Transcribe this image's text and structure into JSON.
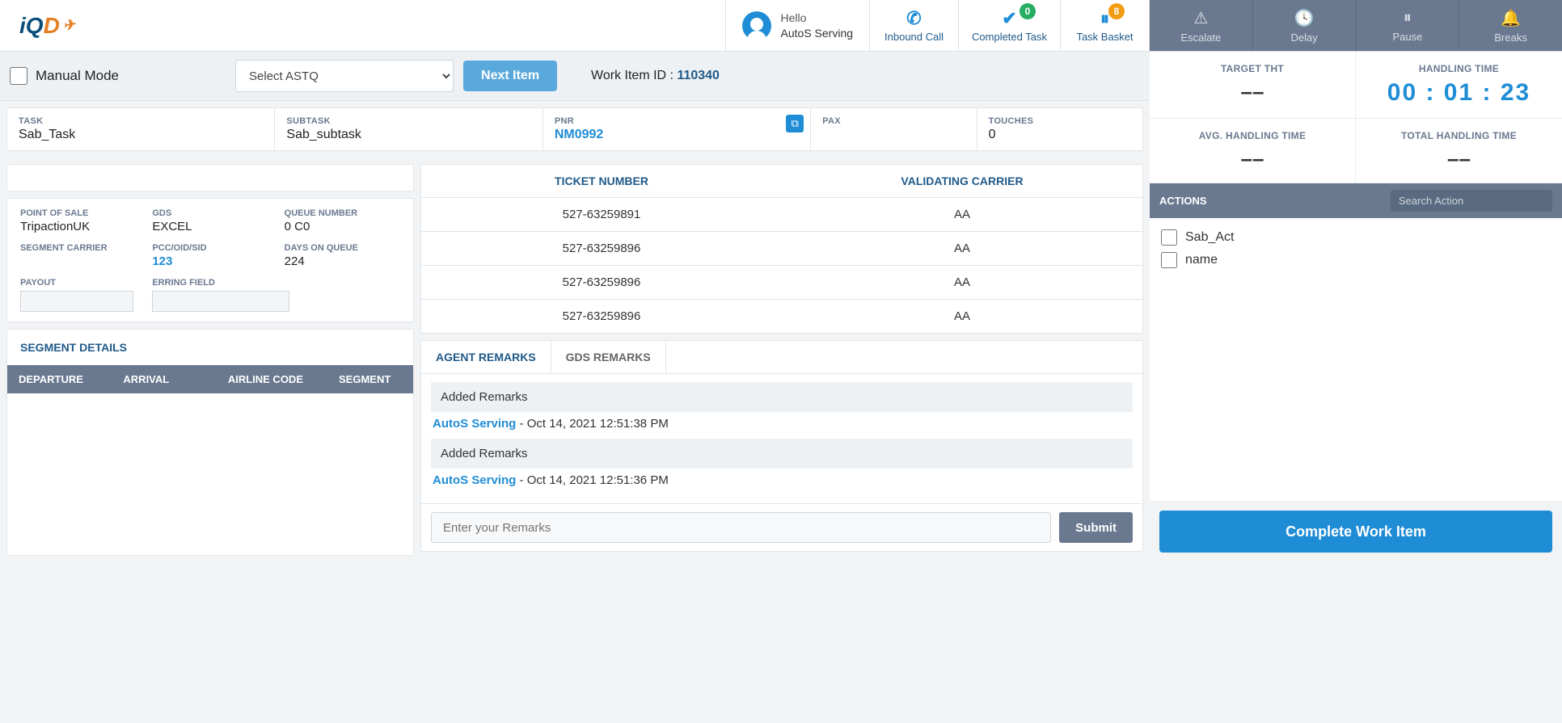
{
  "header": {
    "greeting": "Hello",
    "user_name": "AutoS Serving",
    "inbound_call": "Inbound Call",
    "completed_task": "Completed Task",
    "completed_badge": "0",
    "task_basket": "Task Basket",
    "basket_badge": "8"
  },
  "action_strip": {
    "escalate": "Escalate",
    "delay": "Delay",
    "pause": "Pause",
    "breaks": "Breaks"
  },
  "subbar": {
    "manual_mode": "Manual Mode",
    "select_astq_placeholder": "Select ASTQ",
    "next_item": "Next Item",
    "work_item_label": "Work Item ID :",
    "work_item_id": "110340"
  },
  "info": {
    "task_label": "TASK",
    "task_value": "Sab_Task",
    "subtask_label": "SUBTASK",
    "subtask_value": "Sab_subtask",
    "pnr_label": "PNR",
    "pnr_value": "NM0992",
    "pax_label": "PAX",
    "pax_value": "",
    "touches_label": "TOUCHES",
    "touches_value": "0"
  },
  "details": {
    "pos_label": "POINT OF SALE",
    "pos_value": "TripactionUK",
    "gds_label": "GDS",
    "gds_value": "EXCEL",
    "queue_label": "QUEUE NUMBER",
    "queue_value": "0  C0",
    "seg_carrier_label": "SEGMENT CARRIER",
    "seg_carrier_value": "",
    "pcc_label": "PCC/OID/SID",
    "pcc_value": "123",
    "days_label": "DAYS ON QUEUE",
    "days_value": "224",
    "payout_label": "PAYOUT",
    "erring_label": "ERRING FIELD"
  },
  "segment": {
    "title": "SEGMENT DETAILS",
    "col_dep": "DEPARTURE",
    "col_arr": "ARRIVAL",
    "col_air": "AIRLINE CODE",
    "col_seg": "SEGMENT"
  },
  "tickets": {
    "col_ticket": "TICKET NUMBER",
    "col_carrier": "VALIDATING CARRIER",
    "rows": [
      {
        "ticket": "527-63259891",
        "carrier": "AA"
      },
      {
        "ticket": "527-63259896",
        "carrier": "AA"
      },
      {
        "ticket": "527-63259896",
        "carrier": "AA"
      },
      {
        "ticket": "527-63259896",
        "carrier": "AA"
      }
    ]
  },
  "remarks": {
    "tab_agent": "AGENT REMARKS",
    "tab_gds": "GDS REMARKS",
    "items": [
      {
        "title": "Added Remarks",
        "author": "AutoS Serving",
        "time": "Oct 14, 2021 12:51:38 PM"
      },
      {
        "title": "Added Remarks",
        "author": "AutoS Serving",
        "time": "Oct 14, 2021 12:51:36 PM"
      }
    ],
    "input_placeholder": "Enter your Remarks",
    "submit": "Submit"
  },
  "metrics": {
    "target_tht_label": "TARGET THT",
    "target_tht_value": "––",
    "handling_time_label": "HANDLING TIME",
    "handling_time_value": "00 : 01 : 23",
    "avg_label": "AVG. HANDLING TIME",
    "avg_value": "––",
    "total_label": "TOTAL HANDLING TIME",
    "total_value": "––"
  },
  "actions": {
    "header": "ACTIONS",
    "search_placeholder": "Search Action",
    "items": [
      {
        "label": "Sab_Act"
      },
      {
        "label": "name"
      }
    ],
    "complete": "Complete Work Item"
  }
}
